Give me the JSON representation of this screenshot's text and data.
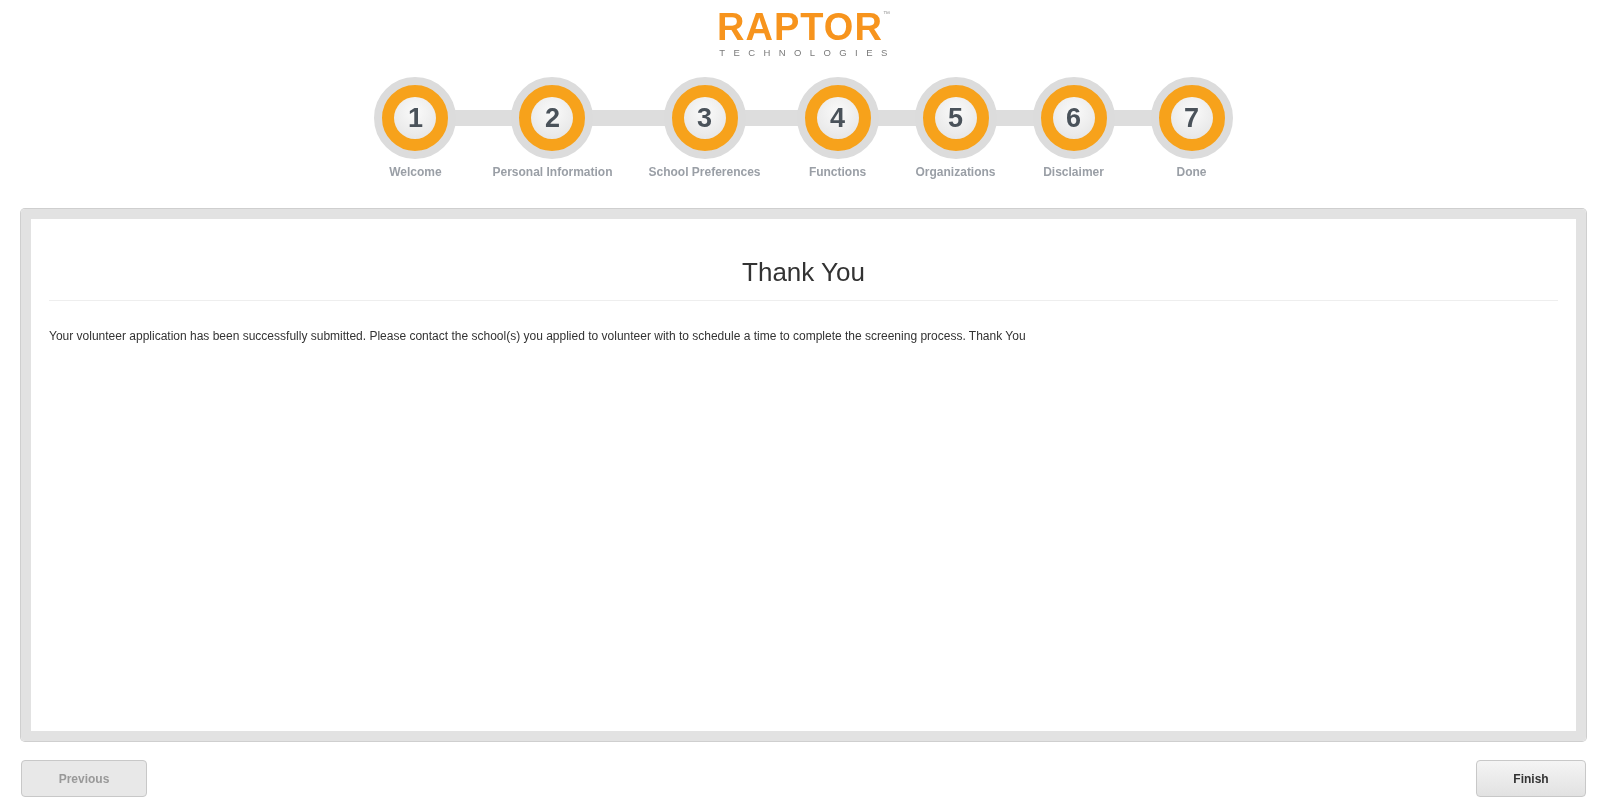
{
  "logo": {
    "name": "RAPTOR",
    "trademark": "™",
    "tagline": "TECHNOLOGIES"
  },
  "steps": [
    {
      "number": "1",
      "label": "Welcome",
      "completed": true
    },
    {
      "number": "2",
      "label": "Personal Information",
      "completed": true
    },
    {
      "number": "3",
      "label": "School Preferences",
      "completed": true
    },
    {
      "number": "4",
      "label": "Functions",
      "completed": true
    },
    {
      "number": "5",
      "label": "Organizations",
      "completed": true
    },
    {
      "number": "6",
      "label": "Disclaimer",
      "completed": true
    },
    {
      "number": "7",
      "label": "Done",
      "completed": true
    }
  ],
  "panel": {
    "title": "Thank You",
    "message": "Your volunteer application has been successfully submitted. Please contact the school(s) you applied to volunteer with to schedule a time to complete the screening process. Thank You"
  },
  "buttons": [
    {
      "label": "Previous",
      "disabled": true
    },
    {
      "label": "Finish",
      "disabled": false
    }
  ]
}
